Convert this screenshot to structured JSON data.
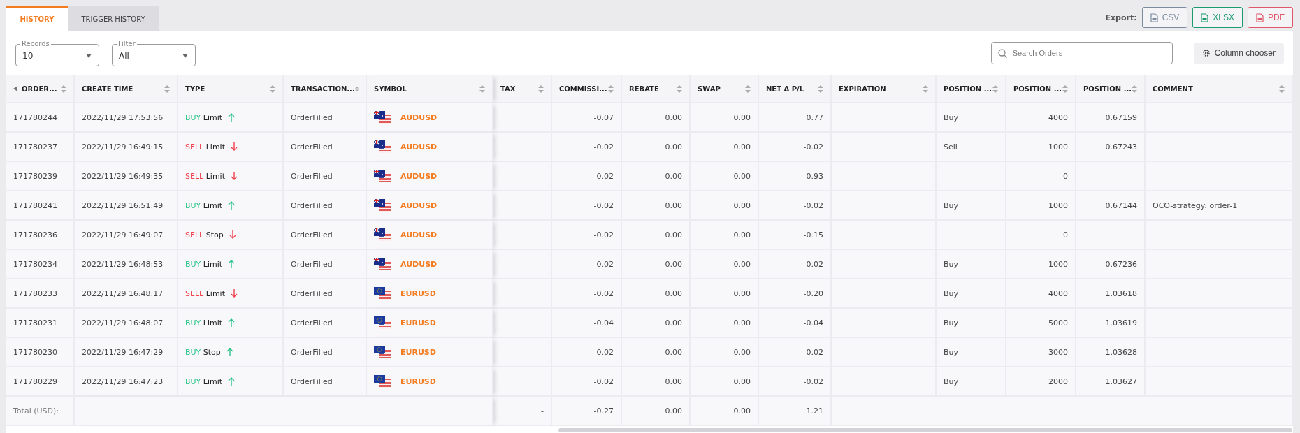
{
  "tabs": [
    {
      "label": "HISTORY",
      "selected": true
    },
    {
      "label": "TRIGGER HISTORY",
      "selected": false
    }
  ],
  "export": {
    "label": "Export:",
    "buttons": [
      {
        "label": "CSV",
        "kind": "csv"
      },
      {
        "label": "XLSX",
        "kind": "xlsx"
      },
      {
        "label": "PDF",
        "kind": "pdf"
      }
    ]
  },
  "filters": [
    {
      "label": "Records",
      "value": "10"
    },
    {
      "label": "Filter",
      "value": "All"
    }
  ],
  "search": {
    "placeholder": "Search Orders"
  },
  "column_chooser": "Column chooser",
  "columns": [
    "ORDER...",
    "CREATE TIME",
    "TYPE",
    "TRANSACTION...",
    "SYMBOL",
    "TAX",
    "COMMISSI...",
    "REBATE",
    "SWAP",
    "NET Δ P/L",
    "EXPIRATION",
    "POSITION ...",
    "POSITION ...",
    "POSITION ...",
    "COMMENT"
  ],
  "rows": [
    {
      "order": "171780244",
      "time": "2022/11/29 17:53:56",
      "type": {
        "kind": "up",
        "side": "BUY",
        "order_type": "Limit"
      },
      "transaction": "OrderFilled",
      "symbol": {
        "kind": "au",
        "label": "AUDUSD"
      },
      "commission": "-0.07",
      "rebate": "0.00",
      "swap": "0.00",
      "net": "0.77",
      "position_1": "Buy",
      "position_2": "4000",
      "position_3": "0.67159"
    },
    {
      "order": "171780237",
      "time": "2022/11/29 16:49:15",
      "type": {
        "kind": "down",
        "side": "SELL",
        "order_type": "Limit"
      },
      "transaction": "OrderFilled",
      "symbol": {
        "kind": "au",
        "label": "AUDUSD"
      },
      "commission": "-0.02",
      "rebate": "0.00",
      "swap": "0.00",
      "net": "-0.02",
      "position_1": "Sell",
      "position_2": "1000",
      "position_3": "0.67243"
    },
    {
      "order": "171780239",
      "time": "2022/11/29 16:49:35",
      "type": {
        "kind": "down",
        "side": "SELL",
        "order_type": "Limit"
      },
      "transaction": "OrderFilled",
      "symbol": {
        "kind": "au",
        "label": "AUDUSD"
      },
      "commission": "-0.02",
      "rebate": "0.00",
      "swap": "0.00",
      "net": "0.93",
      "position_2": "0"
    },
    {
      "order": "171780241",
      "time": "2022/11/29 16:51:49",
      "type": {
        "kind": "up",
        "side": "BUY",
        "order_type": "Limit"
      },
      "transaction": "OrderFilled",
      "symbol": {
        "kind": "au",
        "label": "AUDUSD"
      },
      "commission": "-0.02",
      "rebate": "0.00",
      "swap": "0.00",
      "net": "-0.02",
      "position_1": "Buy",
      "position_2": "1000",
      "position_3": "0.67144",
      "comment": "OCO-strategy: order-1"
    },
    {
      "order": "171780236",
      "time": "2022/11/29 16:49:07",
      "type": {
        "kind": "down",
        "side": "SELL",
        "order_type": "Stop"
      },
      "transaction": "OrderFilled",
      "symbol": {
        "kind": "au",
        "label": "AUDUSD"
      },
      "commission": "-0.02",
      "rebate": "0.00",
      "swap": "0.00",
      "net": "-0.15",
      "position_2": "0"
    },
    {
      "order": "171780234",
      "time": "2022/11/29 16:48:53",
      "type": {
        "kind": "up",
        "side": "BUY",
        "order_type": "Limit"
      },
      "transaction": "OrderFilled",
      "symbol": {
        "kind": "au",
        "label": "AUDUSD"
      },
      "commission": "-0.02",
      "rebate": "0.00",
      "swap": "0.00",
      "net": "-0.02",
      "position_1": "Buy",
      "position_2": "1000",
      "position_3": "0.67236"
    },
    {
      "order": "171780233",
      "time": "2022/11/29 16:48:17",
      "type": {
        "kind": "down",
        "side": "SELL",
        "order_type": "Limit"
      },
      "transaction": "OrderFilled",
      "symbol": {
        "kind": "eu",
        "label": "EURUSD"
      },
      "commission": "-0.02",
      "rebate": "0.00",
      "swap": "0.00",
      "net": "-0.20",
      "position_1": "Buy",
      "position_2": "4000",
      "position_3": "1.03618"
    },
    {
      "order": "171780231",
      "time": "2022/11/29 16:48:07",
      "type": {
        "kind": "up",
        "side": "BUY",
        "order_type": "Limit"
      },
      "transaction": "OrderFilled",
      "symbol": {
        "kind": "eu",
        "label": "EURUSD"
      },
      "commission": "-0.04",
      "rebate": "0.00",
      "swap": "0.00",
      "net": "-0.04",
      "position_1": "Buy",
      "position_2": "5000",
      "position_3": "1.03619"
    },
    {
      "order": "171780230",
      "time": "2022/11/29 16:47:29",
      "type": {
        "kind": "up",
        "side": "BUY",
        "order_type": "Stop"
      },
      "transaction": "OrderFilled",
      "symbol": {
        "kind": "eu",
        "label": "EURUSD"
      },
      "commission": "-0.02",
      "rebate": "0.00",
      "swap": "0.00",
      "net": "-0.02",
      "position_1": "Buy",
      "position_2": "3000",
      "position_3": "1.03628"
    },
    {
      "order": "171780229",
      "time": "2022/11/29 16:47:23",
      "type": {
        "kind": "up",
        "side": "BUY",
        "order_type": "Limit"
      },
      "transaction": "OrderFilled",
      "symbol": {
        "kind": "eu",
        "label": "EURUSD"
      },
      "commission": "-0.02",
      "rebate": "0.00",
      "swap": "0.00",
      "net": "-0.02",
      "position_1": "Buy",
      "position_2": "2000",
      "position_3": "1.03627"
    }
  ],
  "total": {
    "label": "Total (USD):",
    "tax": "-",
    "commission": "-0.27",
    "rebate": "0.00",
    "swap": "0.00",
    "net": "1.21"
  }
}
